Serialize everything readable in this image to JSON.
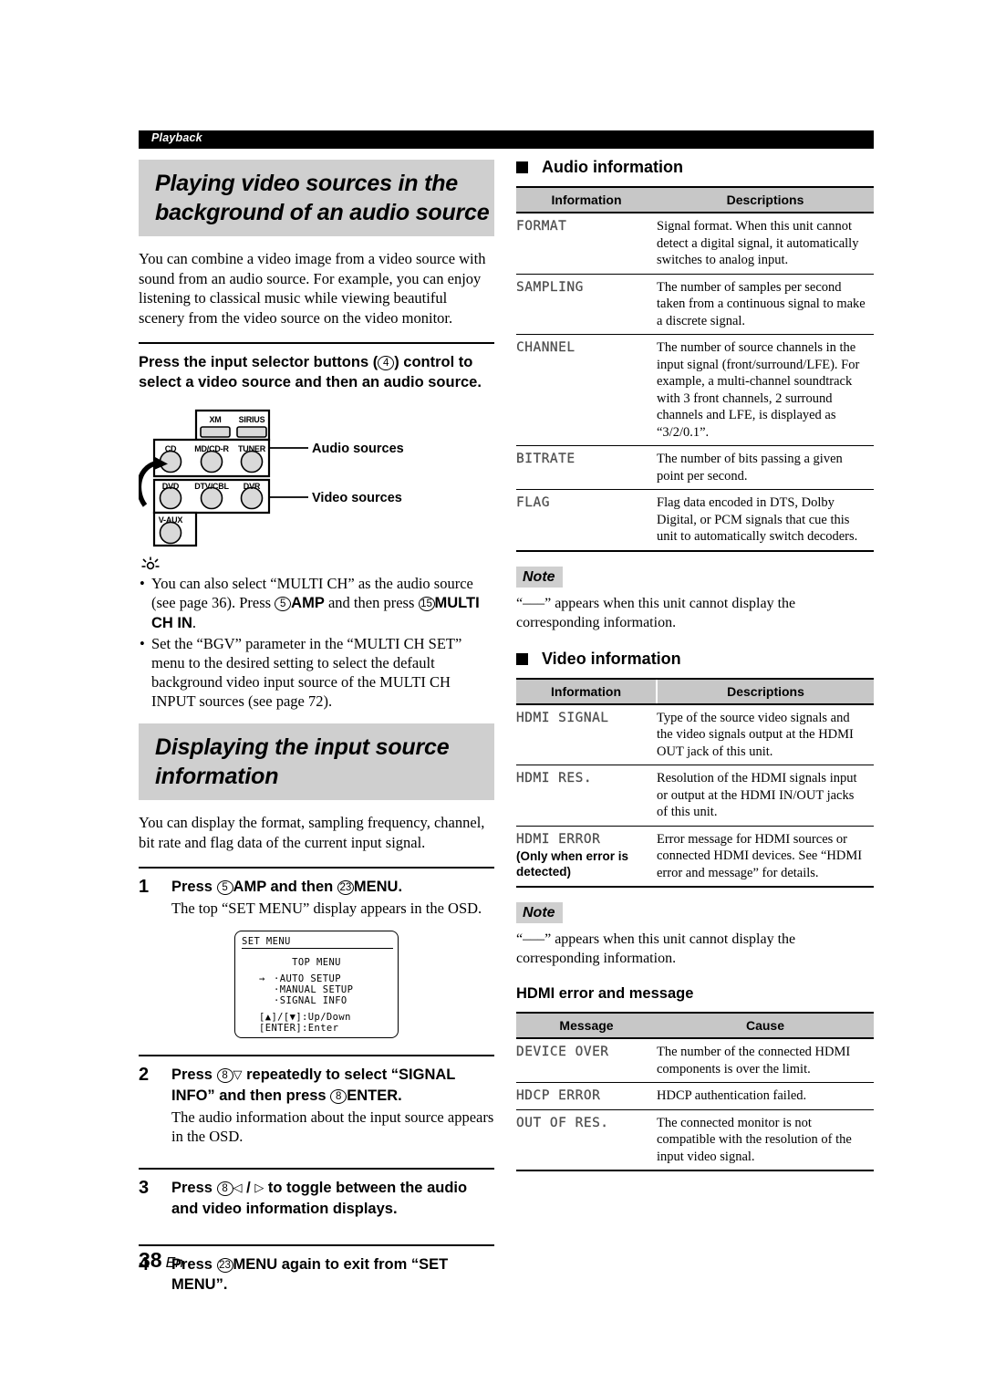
{
  "running_head": "Playback",
  "folio": {
    "page": "38",
    "lang": "En"
  },
  "left": {
    "title1": "Playing video sources in the background of an audio source",
    "intro1": "You can combine a video image from a video source with sound from an audio source. For example, you can enjoy listening to classical music while viewing beautiful scenery from the video source on the video monitor.",
    "instruction_bold": "Press the input selector buttons (4) control to select a video source and then an audio source.",
    "diagram": {
      "audio_label": "Audio sources",
      "video_label": "Video sources",
      "buttons": {
        "xm": "XM",
        "sirius": "SIRIUS",
        "cd": "CD",
        "mdcdr": "MD/CD-R",
        "tuner": "TUNER",
        "dvd": "DVD",
        "dtvcbl": "DTV/CBL",
        "dvr": "DVR",
        "vaux": "V-AUX"
      }
    },
    "tips": [
      "You can also select “MULTI CH” as the audio source (see page 36). Press 5 AMP and then press 15 MULTI CH IN.",
      "Set the “BGV” parameter in the “MULTI CH SET” menu to the desired setting to select the default background video input source of the MULTI CH INPUT sources (see page 72)."
    ],
    "title2": "Displaying the input source information",
    "intro2": "You can display the format, sampling frequency, channel, bit rate and flag data of the current input signal.",
    "steps": [
      {
        "num": "1",
        "head": "Press 5 AMP and then 23 MENU.",
        "sub": "The top “SET MENU” display appears in the OSD."
      },
      {
        "num": "2",
        "head": "Press 8 ▽ repeatedly to select “SIGNAL INFO” and then press 8 ENTER.",
        "sub": "The audio information about the input source appears in the OSD."
      },
      {
        "num": "3",
        "head": "Press 8 ◁ / ▷ to toggle between the audio and video information displays.",
        "sub": ""
      },
      {
        "num": "4",
        "head": "Press 23 MENU again to exit from “SET MENU”.",
        "sub": ""
      }
    ],
    "osd": {
      "tab": "SET MENU",
      "top_menu": "TOP MENU",
      "cursor": "→",
      "items": [
        "·AUTO SETUP",
        "·MANUAL SETUP",
        "·SIGNAL INFO"
      ],
      "hint1": "[▲]/[▼]:Up/Down",
      "hint2": "[ENTER]:Enter"
    }
  },
  "right": {
    "audio_section": {
      "heading": "Audio information",
      "columns": [
        "Information",
        "Descriptions"
      ],
      "rows": [
        {
          "info": "FORMAT",
          "cond": "",
          "desc": "Signal format. When this unit cannot detect a digital signal, it automatically switches to analog input."
        },
        {
          "info": "SAMPLING",
          "cond": "",
          "desc": "The number of samples per second taken from a continuous signal to make a discrete signal."
        },
        {
          "info": "CHANNEL",
          "cond": "",
          "desc": "The number of source channels in the input signal (front/surround/LFE). For example, a multi-channel soundtrack with 3 front channels, 2 surround channels and LFE, is displayed as “3/2/0.1”."
        },
        {
          "info": "BITRATE",
          "cond": "",
          "desc": "The number of bits passing a given point per second."
        },
        {
          "info": "FLAG",
          "cond": "",
          "desc": "Flag data encoded in DTS, Dolby Digital, or PCM signals that cue this unit to automatically switch decoders."
        }
      ]
    },
    "note1": {
      "badge": "Note",
      "text": "“–––” appears when this unit cannot display the corresponding information."
    },
    "video_section": {
      "heading": "Video information",
      "columns": [
        "Information",
        "Descriptions"
      ],
      "rows": [
        {
          "info": "HDMI SIGNAL",
          "cond": "",
          "desc": "Type of the source video signals and the video signals output at the HDMI OUT jack of this unit."
        },
        {
          "info": "HDMI RES.",
          "cond": "",
          "desc": "Resolution of the HDMI signals input or output at the HDMI IN/OUT jacks of this unit."
        },
        {
          "info": "HDMI ERROR",
          "cond": "(Only when error is detected)",
          "desc": "Error message for HDMI sources or connected HDMI devices. See “HDMI error and message” for details."
        }
      ]
    },
    "note2": {
      "badge": "Note",
      "text": "“–––” appears when this unit cannot display the corresponding information."
    },
    "error_section": {
      "heading": "HDMI error and message",
      "columns": [
        "Message",
        "Cause"
      ],
      "rows": [
        {
          "info": "DEVICE OVER",
          "cond": "",
          "desc": "The number of the connected HDMI components is over the limit."
        },
        {
          "info": "HDCP ERROR",
          "cond": "",
          "desc": "HDCP authentication failed."
        },
        {
          "info": "OUT OF RES.",
          "cond": "",
          "desc": "The connected monitor is not compatible with the resolution of the input video signal."
        }
      ]
    }
  }
}
